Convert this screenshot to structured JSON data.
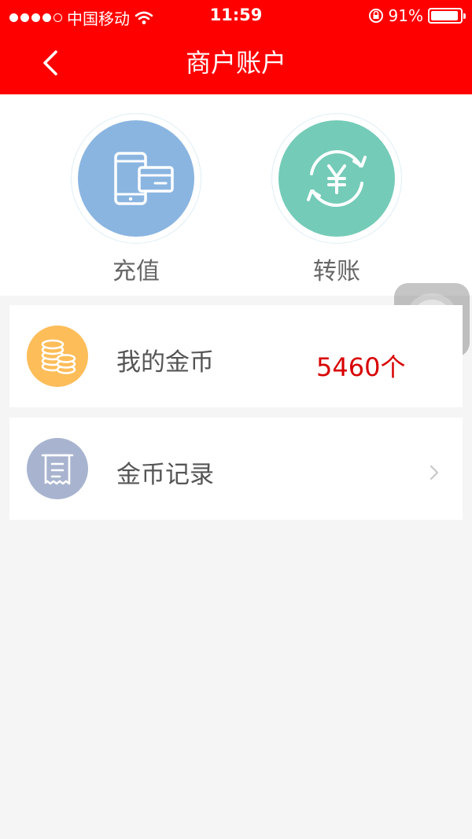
{
  "status_bar": {
    "carrier": "中国移动",
    "time": "11:59",
    "battery": "91%"
  },
  "header": {
    "title": "商户账户"
  },
  "actions": [
    {
      "label": "充值",
      "icon": "phone-card-icon",
      "color": "#8ab5e0"
    },
    {
      "label": "转账",
      "icon": "yuan-transfer-icon",
      "color": "#74cbb8"
    }
  ],
  "cards": {
    "coins": {
      "label": "我的金币",
      "value": "5460个",
      "icon": "coins-icon",
      "color": "#fdbd59"
    },
    "record": {
      "label": "金币记录",
      "icon": "receipt-icon",
      "color": "#a8b4cf"
    }
  },
  "colors": {
    "brand": "#ff0000",
    "value": "#d80000"
  }
}
